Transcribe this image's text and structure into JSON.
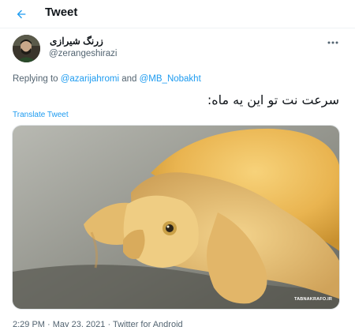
{
  "header": {
    "title": "Tweet",
    "back_icon": "arrow-left-icon",
    "accent": "#1d9bf0"
  },
  "author": {
    "display_name": "زرنگ شیرازی",
    "handle": "@zerangeshirazi",
    "avatar_icon": "user-avatar"
  },
  "replying": {
    "prefix": "Replying to ",
    "user1": "@azarijahromi",
    "conjunction": " and ",
    "user2": "@MB_Nobakht"
  },
  "tweet": {
    "text": "سرعت نت تو این یه ماه:",
    "translate_label": "Translate Tweet"
  },
  "media": {
    "watermark": "TABNAKRAFO.IR",
    "description_icon": "photo-golden-turtle"
  },
  "meta": {
    "time": "2:29 PM",
    "separator": " · ",
    "date": "May 23, 2021",
    "separator2": " · ",
    "source": "Twitter for Android"
  }
}
